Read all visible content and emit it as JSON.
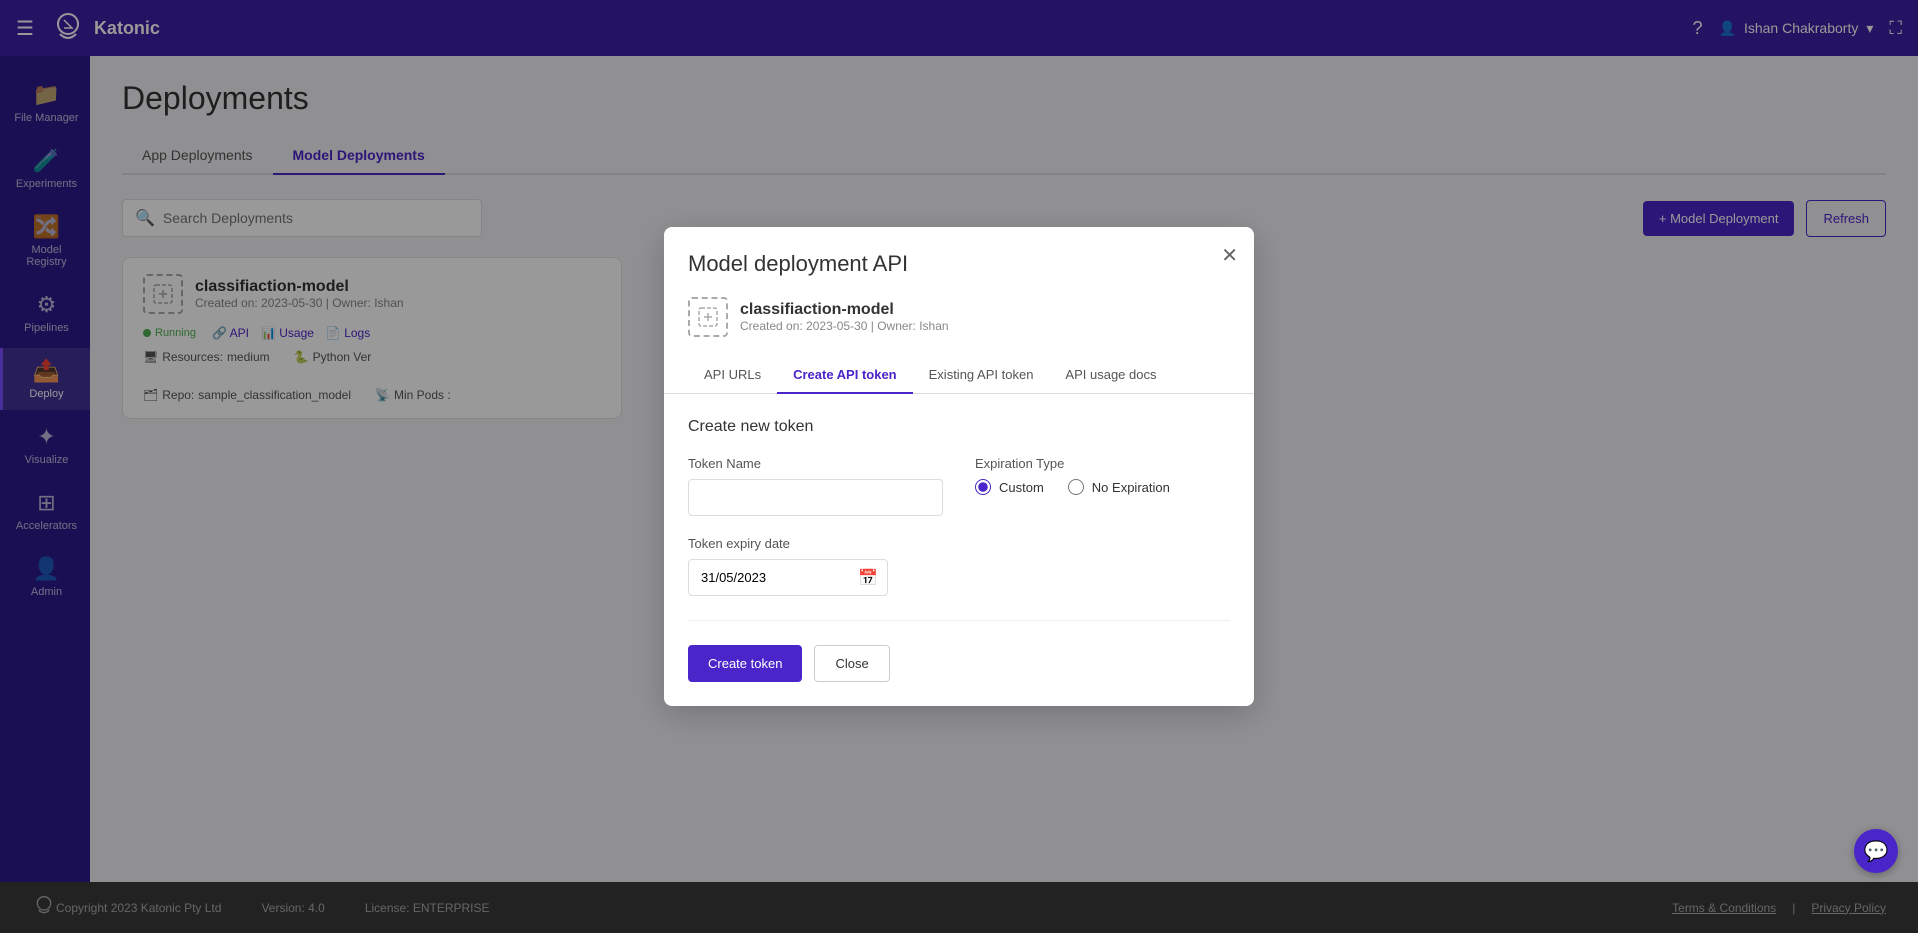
{
  "app": {
    "name": "Katonic"
  },
  "topnav": {
    "hamburger_label": "☰",
    "user_name": "Ishan Chakraborty",
    "help_icon": "?",
    "expand_icon": "⛶"
  },
  "sidebar": {
    "items": [
      {
        "id": "file-manager",
        "label": "File Manager",
        "icon": "📁",
        "active": false
      },
      {
        "id": "experiments",
        "label": "Experiments",
        "icon": "🧪",
        "active": false
      },
      {
        "id": "model-registry",
        "label": "Model Registry",
        "icon": "🔀",
        "active": false
      },
      {
        "id": "pipelines",
        "label": "Pipelines",
        "icon": "⚙",
        "active": false
      },
      {
        "id": "deploy",
        "label": "Deploy",
        "icon": "📤",
        "active": true
      },
      {
        "id": "visualize",
        "label": "Visualize",
        "icon": "✦",
        "active": false
      },
      {
        "id": "accelerators",
        "label": "Accelerators",
        "icon": "⊞",
        "active": false
      },
      {
        "id": "admin",
        "label": "Admin",
        "icon": "👤",
        "active": false
      }
    ]
  },
  "page": {
    "title": "Deployments",
    "tabs": [
      {
        "id": "app",
        "label": "App Deployments",
        "active": false
      },
      {
        "id": "model",
        "label": "Model Deployments",
        "active": true
      }
    ]
  },
  "toolbar": {
    "search_placeholder": "Search Deployments",
    "add_button": "+ Model Deployment",
    "refresh_button": "Refresh"
  },
  "deployment_card": {
    "model_name": "classiﬁaction-model",
    "created": "Created on: 2023-05-30 | Owner: Ishan",
    "status": "Running",
    "links": [
      "API",
      "Usage",
      "Logs"
    ],
    "resources_label": "Resources:",
    "resources_value": "medium",
    "python_label": "Python Ver",
    "repo_label": "Repo:",
    "repo_value": "sample_classification_model",
    "min_pods_label": "Min Pods :"
  },
  "modal": {
    "title": "Model deployment API",
    "model_name": "classiﬁaction-model",
    "model_created": "Created on: 2023-05-30 | Owner: Ishan",
    "tabs": [
      {
        "id": "api-urls",
        "label": "API URLs",
        "active": false
      },
      {
        "id": "create-api-token",
        "label": "Create API token",
        "active": true
      },
      {
        "id": "existing-api-token",
        "label": "Existing API token",
        "active": false
      },
      {
        "id": "api-usage-docs",
        "label": "API usage docs",
        "active": false
      }
    ],
    "section_title": "Create new token",
    "token_name_label": "Token Name",
    "token_name_placeholder": "",
    "expiration_type_label": "Expiration Type",
    "expiration_options": [
      {
        "id": "custom",
        "label": "Custom",
        "checked": true
      },
      {
        "id": "no-expiration",
        "label": "No Expiration",
        "checked": false
      }
    ],
    "token_expiry_label": "Token expiry date",
    "token_expiry_value": "31/05/2023",
    "create_button": "Create token",
    "close_button": "Close"
  },
  "footer": {
    "copyright": "Copyright 2023 Katonic Pty Ltd",
    "version": "Version: 4.0",
    "license": "License: ENTERPRISE",
    "terms": "Terms & Conditions",
    "privacy": "Privacy Policy"
  },
  "colors": {
    "primary": "#4a25c9",
    "nav_bg": "#3d1fa3",
    "sidebar_bg": "#2d1a8a",
    "running_green": "#4caf50"
  }
}
